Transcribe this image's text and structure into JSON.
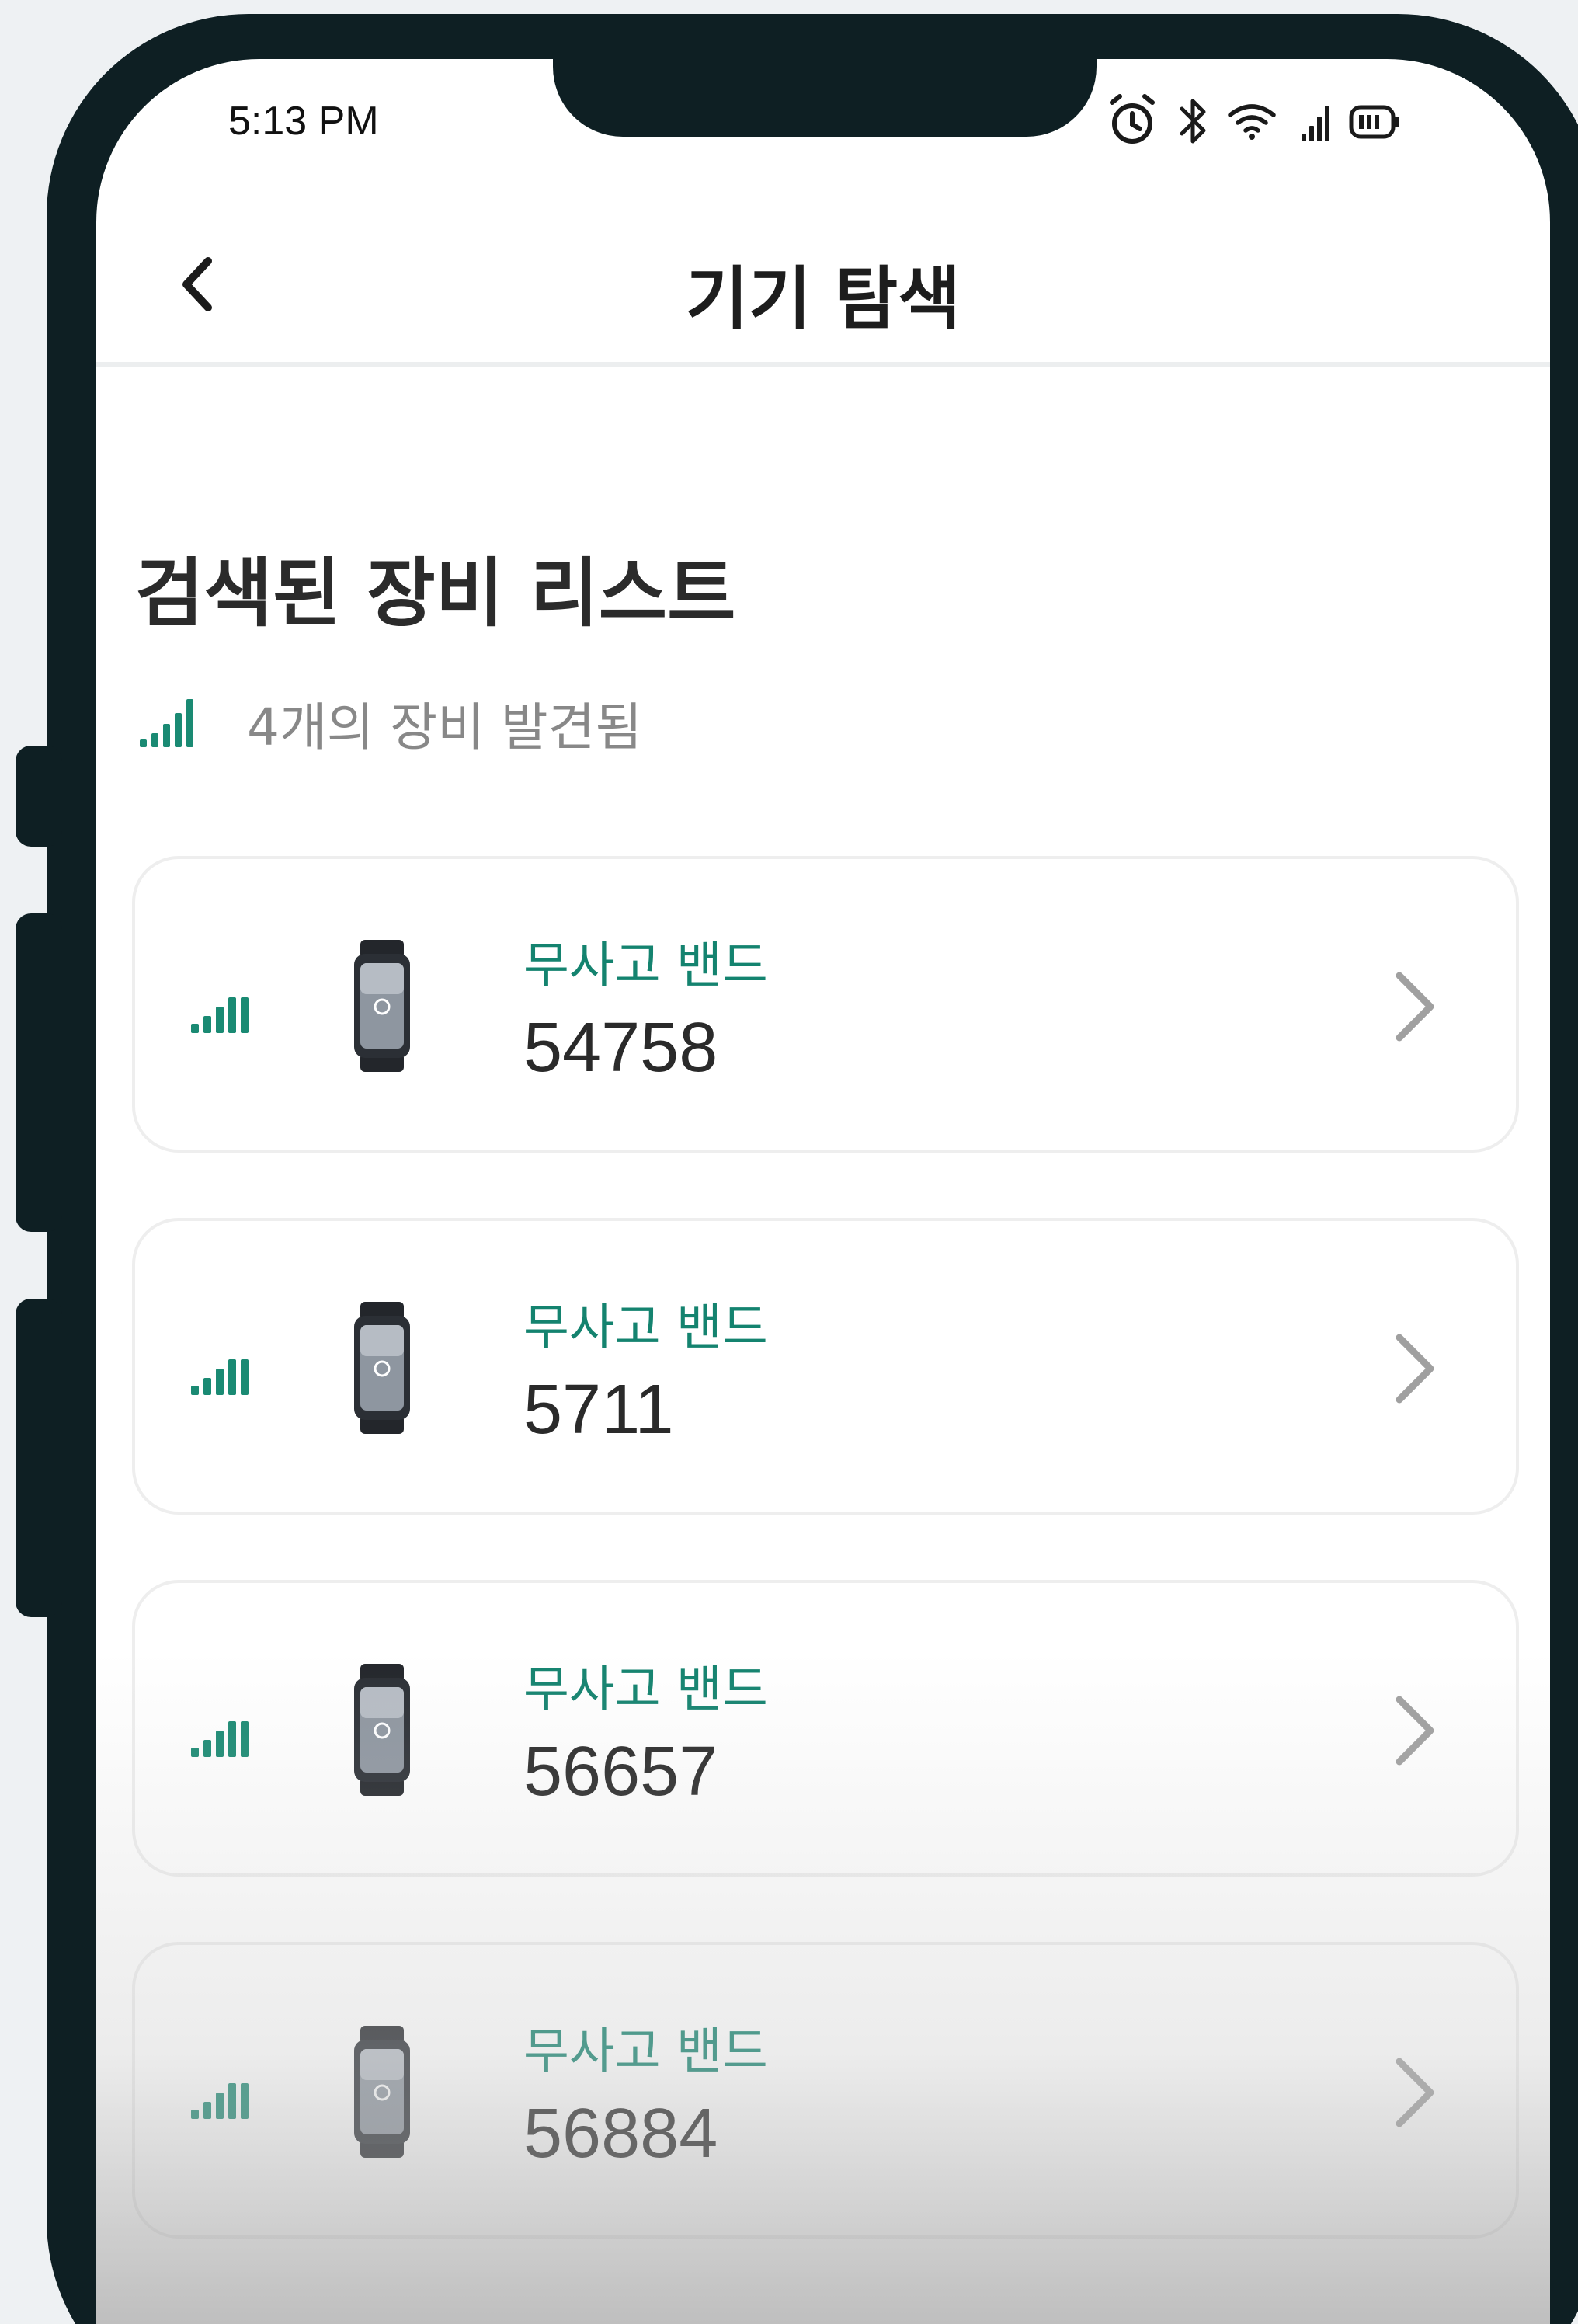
{
  "status_bar": {
    "time": "5:13 PM",
    "icons": [
      "alarm-icon",
      "bluetooth-icon",
      "wifi-icon",
      "cellular-signal-icon",
      "battery-icon"
    ]
  },
  "header": {
    "title": "기기 탐색",
    "back_icon": "chevron-left-icon"
  },
  "section": {
    "title": "검색된 장비 리스트",
    "found_text": "4개의 장비 발견됨"
  },
  "devices": [
    {
      "name": "무사고 밴드",
      "id": "54758"
    },
    {
      "name": "무사고 밴드",
      "id": "5711"
    },
    {
      "name": "무사고 밴드",
      "id": "56657"
    },
    {
      "name": "무사고 밴드",
      "id": "56884"
    }
  ],
  "colors": {
    "accent": "#14836f",
    "signal": "#1a8a73",
    "frame": "#0e1f23",
    "background": "#eef1f3"
  }
}
